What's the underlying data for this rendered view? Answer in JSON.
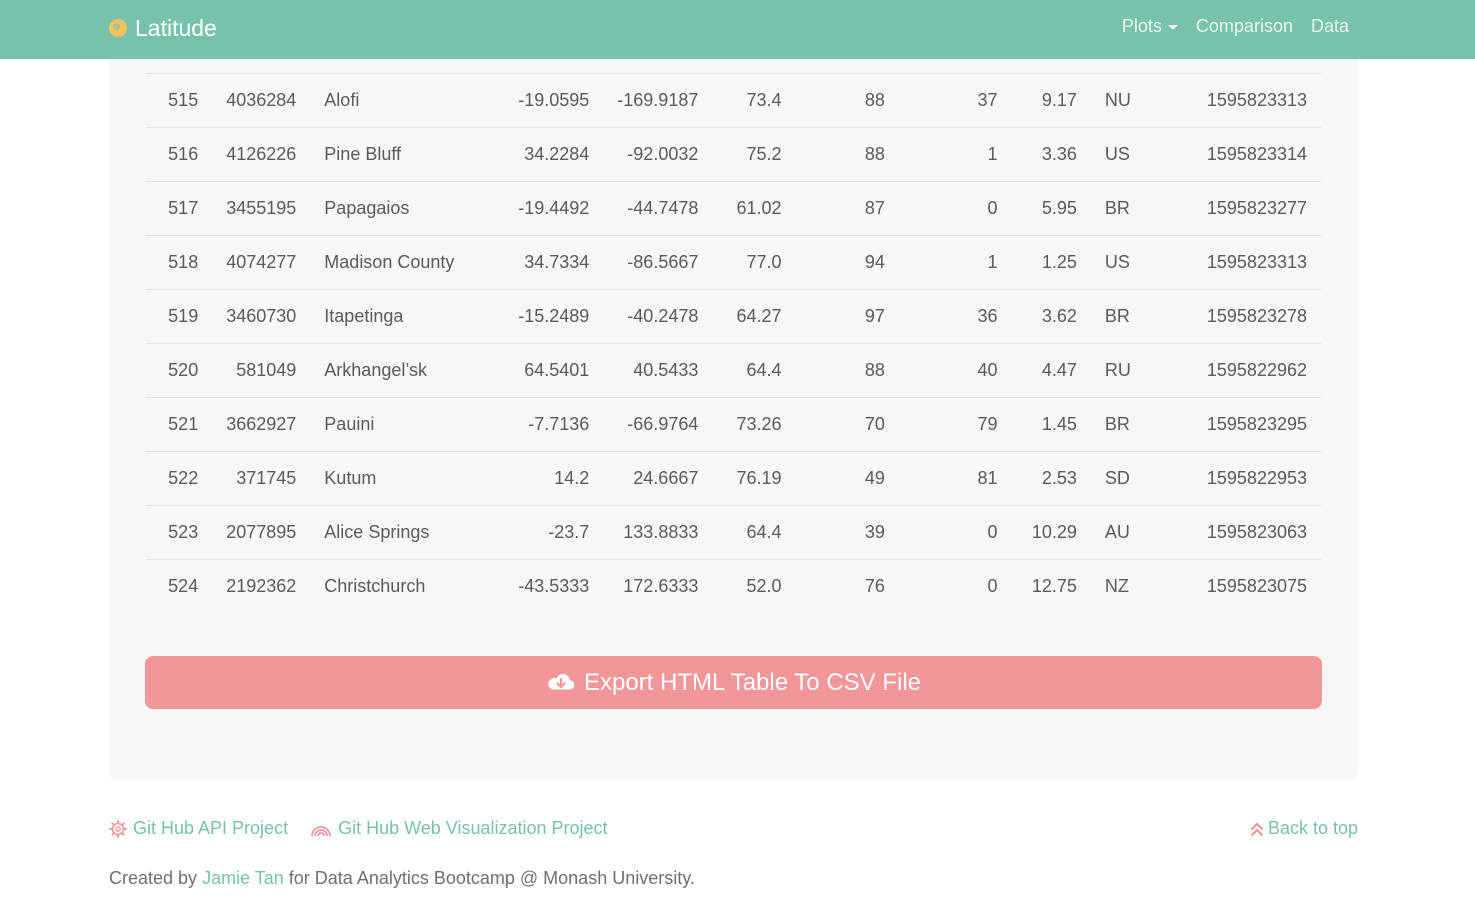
{
  "navbar": {
    "brand": "Latitude",
    "links": [
      {
        "label": "Plots",
        "dropdown": true
      },
      {
        "label": "Comparison",
        "dropdown": false
      },
      {
        "label": "Data",
        "dropdown": false
      }
    ]
  },
  "table": {
    "rows": [
      [
        "515",
        "4036284",
        "Alofi",
        "-19.0595",
        "-169.9187",
        "73.4",
        "88",
        "37",
        "9.17",
        "NU",
        "1595823313"
      ],
      [
        "516",
        "4126226",
        "Pine Bluff",
        "34.2284",
        "-92.0032",
        "75.2",
        "88",
        "1",
        "3.36",
        "US",
        "1595823314"
      ],
      [
        "517",
        "3455195",
        "Papagaios",
        "-19.4492",
        "-44.7478",
        "61.02",
        "87",
        "0",
        "5.95",
        "BR",
        "1595823277"
      ],
      [
        "518",
        "4074277",
        "Madison County",
        "34.7334",
        "-86.5667",
        "77.0",
        "94",
        "1",
        "1.25",
        "US",
        "1595823313"
      ],
      [
        "519",
        "3460730",
        "Itapetinga",
        "-15.2489",
        "-40.2478",
        "64.27",
        "97",
        "36",
        "3.62",
        "BR",
        "1595823278"
      ],
      [
        "520",
        "581049",
        "Arkhangel’sk",
        "64.5401",
        "40.5433",
        "64.4",
        "88",
        "40",
        "4.47",
        "RU",
        "1595822962"
      ],
      [
        "521",
        "3662927",
        "Pauini",
        "-7.7136",
        "-66.9764",
        "73.26",
        "70",
        "79",
        "1.45",
        "BR",
        "1595823295"
      ],
      [
        "522",
        "371745",
        "Kutum",
        "14.2",
        "24.6667",
        "76.19",
        "49",
        "81",
        "2.53",
        "SD",
        "1595822953"
      ],
      [
        "523",
        "2077895",
        "Alice Springs",
        "-23.7",
        "133.8833",
        "64.4",
        "39",
        "0",
        "10.29",
        "AU",
        "1595823063"
      ],
      [
        "524",
        "2192362",
        "Christchurch",
        "-43.5333",
        "172.6333",
        "52.0",
        "76",
        "0",
        "12.75",
        "NZ",
        "1595823075"
      ]
    ]
  },
  "export_button": {
    "label": "Export HTML Table To CSV File",
    "icon": "cloud-download-icon"
  },
  "footer": {
    "links": [
      {
        "label": "Git Hub API Project",
        "icon": "gear-icon"
      },
      {
        "label": "Git Hub Web Visualization Project",
        "icon": "rainbow-icon"
      }
    ],
    "back_to_top": "Back to top",
    "credit_prefix": "Created by ",
    "credit_author": "Jamie Tan",
    "credit_suffix": " for Data Analytics Bootcamp @ Monash University."
  },
  "colors": {
    "navbar": "#78c2ad",
    "export_button": "#f3969a",
    "link": "#78c2ad",
    "brand_icon": "#f3c35b"
  }
}
